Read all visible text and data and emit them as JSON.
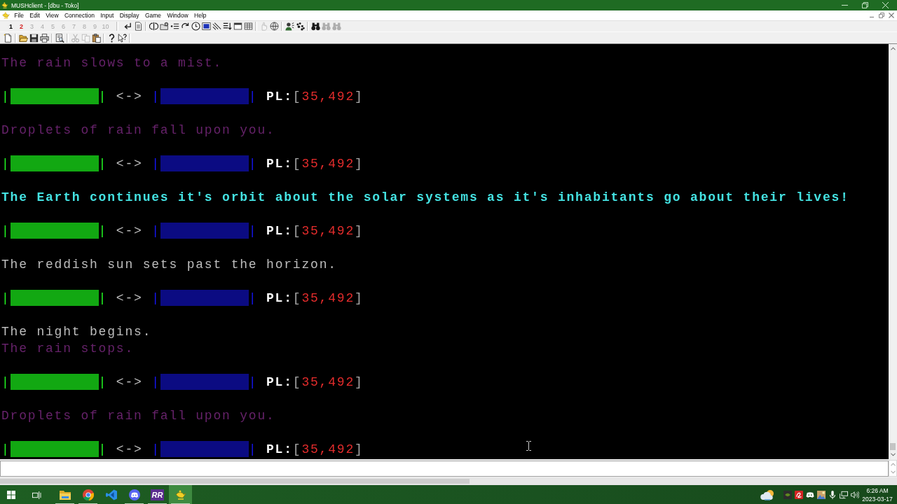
{
  "window": {
    "title": "MUSHclient - [dbu - Toko]"
  },
  "menu_bar": {
    "items": [
      "File",
      "Edit",
      "View",
      "Connection",
      "Input",
      "Display",
      "Game",
      "Window",
      "Help"
    ]
  },
  "world_bar": {
    "items": [
      {
        "label": "1",
        "open": true,
        "new_activity": false
      },
      {
        "label": "2",
        "open": true,
        "new_activity": true
      },
      {
        "label": "3",
        "open": false,
        "new_activity": false
      },
      {
        "label": "4",
        "open": false,
        "new_activity": false
      },
      {
        "label": "5",
        "open": false,
        "new_activity": false
      },
      {
        "label": "6",
        "open": false,
        "new_activity": false
      },
      {
        "label": "7",
        "open": false,
        "new_activity": false
      },
      {
        "label": "8",
        "open": false,
        "new_activity": false
      },
      {
        "label": "9",
        "open": false,
        "new_activity": false
      },
      {
        "label": "10",
        "open": false,
        "new_activity": false
      }
    ]
  },
  "toolbar": {
    "groups": [
      [
        {
          "kind": "return",
          "disabled": false
        },
        {
          "kind": "notes",
          "disabled": false
        }
      ],
      [
        {
          "kind": "split",
          "disabled": false
        },
        {
          "kind": "folder",
          "disabled": false
        },
        {
          "kind": "list",
          "disabled": false
        },
        {
          "kind": "reconnect",
          "disabled": false
        },
        {
          "kind": "clock",
          "disabled": false
        },
        {
          "kind": "screen",
          "disabled": false
        },
        {
          "kind": "slope",
          "disabled": false
        },
        {
          "kind": "sort",
          "disabled": false
        },
        {
          "kind": "window",
          "disabled": false
        },
        {
          "kind": "grid",
          "disabled": false
        }
      ],
      [
        {
          "kind": "hand",
          "disabled": true
        },
        {
          "kind": "globe",
          "disabled": false
        }
      ],
      [
        {
          "kind": "person",
          "disabled": false
        },
        {
          "kind": "paws",
          "disabled": false
        }
      ],
      [
        {
          "kind": "find",
          "disabled": false
        },
        {
          "kind": "find",
          "disabled": true
        },
        {
          "kind": "find",
          "disabled": true
        }
      ]
    ]
  },
  "standard_toolbar": {
    "groups": [
      [
        {
          "kind": "new",
          "disabled": false
        }
      ],
      [
        {
          "kind": "open",
          "disabled": false
        },
        {
          "kind": "save",
          "disabled": false
        },
        {
          "kind": "print",
          "disabled": false
        }
      ],
      [
        {
          "kind": "preview",
          "disabled": false
        }
      ],
      [
        {
          "kind": "cut",
          "disabled": true
        },
        {
          "kind": "copy",
          "disabled": true
        },
        {
          "kind": "paste",
          "disabled": false
        }
      ],
      [
        {
          "kind": "help",
          "disabled": false
        },
        {
          "kind": "pointerhelp",
          "disabled": false
        }
      ]
    ]
  },
  "output": {
    "lines": [
      {
        "kind": "text",
        "text": "The rain slows to a mist.",
        "color": "#66226a",
        "bold": false
      },
      {
        "kind": "prompt",
        "gauges": [
          {
            "open": "|",
            "close": "|",
            "color": "#12a812"
          },
          {
            "open": "|",
            "close": "|",
            "color": "#0b0b82"
          }
        ],
        "separator": "<->",
        "label": "PL:",
        "open_bracket": "[",
        "value": "35,492",
        "close_bracket": "]"
      },
      {
        "kind": "text",
        "text": "Droplets of rain fall upon you.",
        "color": "#66226a",
        "bold": false
      },
      {
        "kind": "prompt",
        "gauges": [
          {
            "open": "|",
            "close": "|",
            "color": "#12a812"
          },
          {
            "open": "|",
            "close": "|",
            "color": "#0b0b82"
          }
        ],
        "separator": "<->",
        "label": "PL:",
        "open_bracket": "[",
        "value": "35,492",
        "close_bracket": "]"
      },
      {
        "kind": "text",
        "text": "The Earth continues it's orbit about the solar systems as it's inhabitants go about their lives!",
        "color": "#44e2e2",
        "bold": true
      },
      {
        "kind": "prompt",
        "gauges": [
          {
            "open": "|",
            "close": "|",
            "color": "#12a812"
          },
          {
            "open": "|",
            "close": "|",
            "color": "#0b0b82"
          }
        ],
        "separator": "<->",
        "label": "PL:",
        "open_bracket": "[",
        "value": "35,492",
        "close_bracket": "]"
      },
      {
        "kind": "text",
        "text": "The reddish sun sets past the horizon.",
        "color": "#bdbdbd",
        "bold": false
      },
      {
        "kind": "prompt",
        "gauges": [
          {
            "open": "|",
            "close": "|",
            "color": "#12a812"
          },
          {
            "open": "|",
            "close": "|",
            "color": "#0b0b82"
          }
        ],
        "separator": "<->",
        "label": "PL:",
        "open_bracket": "[",
        "value": "35,492",
        "close_bracket": "]"
      },
      {
        "kind": "text",
        "text": "The night begins.",
        "color": "#bdbdbd",
        "bold": false
      },
      {
        "kind": "text",
        "text": "The rain stops.",
        "color": "#66226a",
        "bold": false
      },
      {
        "kind": "prompt",
        "gauges": [
          {
            "open": "|",
            "close": "|",
            "color": "#12a812"
          },
          {
            "open": "|",
            "close": "|",
            "color": "#0b0b82"
          }
        ],
        "separator": "<->",
        "label": "PL:",
        "open_bracket": "[",
        "value": "35,492",
        "close_bracket": "]"
      },
      {
        "kind": "text",
        "text": "Droplets of rain fall upon you.",
        "color": "#66226a",
        "bold": false
      },
      {
        "kind": "prompt",
        "gauges": [
          {
            "open": "|",
            "close": "|",
            "color": "#12a812"
          },
          {
            "open": "|",
            "close": "|",
            "color": "#0b0b82"
          }
        ],
        "separator": "<->",
        "label": "PL:",
        "open_bracket": "[",
        "value": "35,492",
        "close_bracket": "]"
      }
    ]
  },
  "taskbar": {
    "apps": [
      {
        "kind": "folder",
        "running": true,
        "selected": false
      },
      {
        "kind": "browser",
        "running": true,
        "selected": false
      },
      {
        "kind": "editor",
        "running": false,
        "selected": false
      },
      {
        "kind": "chat",
        "running": true,
        "selected": false
      },
      {
        "kind": "tile",
        "label": "RR",
        "running": true,
        "selected": false
      },
      {
        "kind": "lamp",
        "running": true,
        "selected": true
      }
    ],
    "clock": {
      "time": "6:26 AM",
      "date": "2023-03-17"
    }
  }
}
